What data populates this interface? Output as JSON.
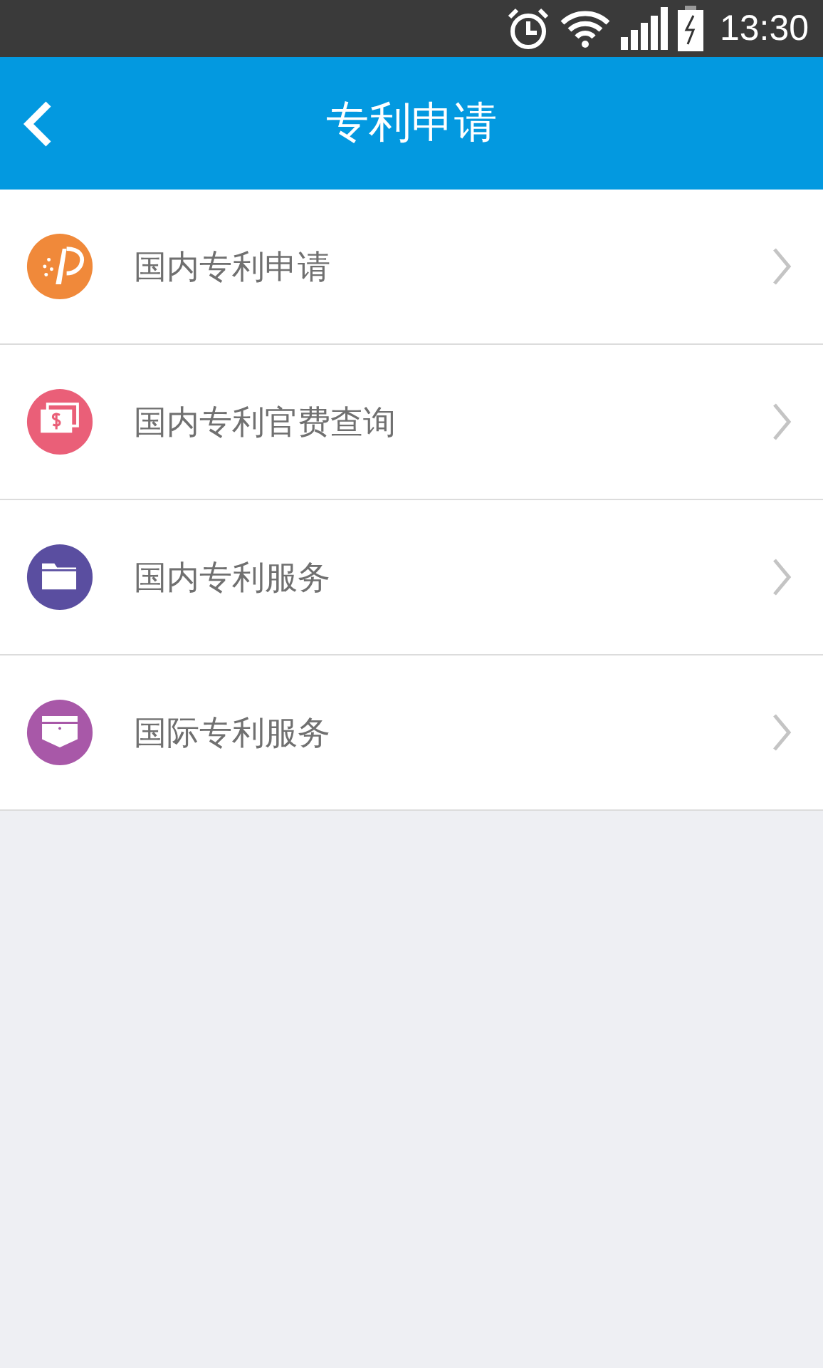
{
  "status_bar": {
    "time": "13:30"
  },
  "header": {
    "title": "专利申请"
  },
  "menu": [
    {
      "label": "国内专利申请",
      "kind": "patent",
      "color": "#f0893a"
    },
    {
      "label": "国内专利官费查询",
      "kind": "money",
      "color": "#ea5f78"
    },
    {
      "label": "国内专利服务",
      "kind": "folder",
      "color": "#5a4ea0"
    },
    {
      "label": "国际专利服务",
      "kind": "pocket",
      "color": "#a858a8"
    }
  ]
}
